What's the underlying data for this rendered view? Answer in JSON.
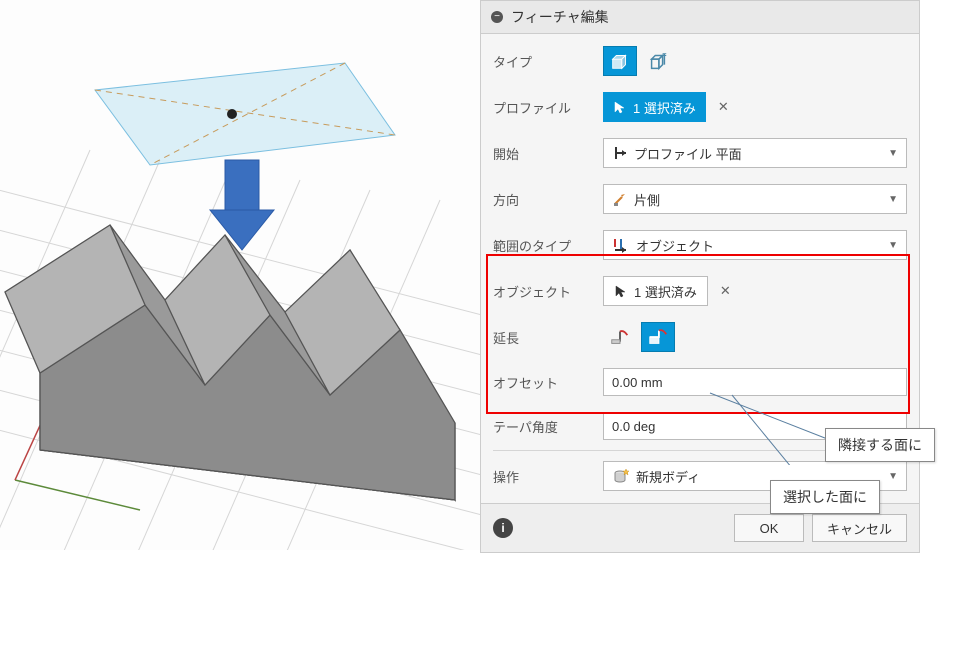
{
  "panel": {
    "title": "フィーチャ編集",
    "rows": {
      "type_label": "タイプ",
      "profile_label": "プロファイル",
      "profile_chip": "1 選択済み",
      "start_label": "開始",
      "start_value": "プロファイル 平面",
      "direction_label": "方向",
      "direction_value": "片側",
      "extent_type_label": "範囲のタイプ",
      "extent_type_value": "オブジェクト",
      "object_label": "オブジェクト",
      "object_chip": "1 選択済み",
      "extend_label": "延長",
      "offset_label": "オフセット",
      "offset_value": "0.00 mm",
      "taper_label": "テーパ角度",
      "taper_value": "0.0 deg",
      "operation_label": "操作",
      "operation_value": "新規ボディ"
    },
    "footer": {
      "ok": "OK",
      "cancel": "キャンセル"
    }
  },
  "callouts": {
    "adjacent": "隣接する面に",
    "selected": "選択した面に"
  },
  "colors": {
    "accent": "#0696d7",
    "highlight": "#e00000"
  }
}
